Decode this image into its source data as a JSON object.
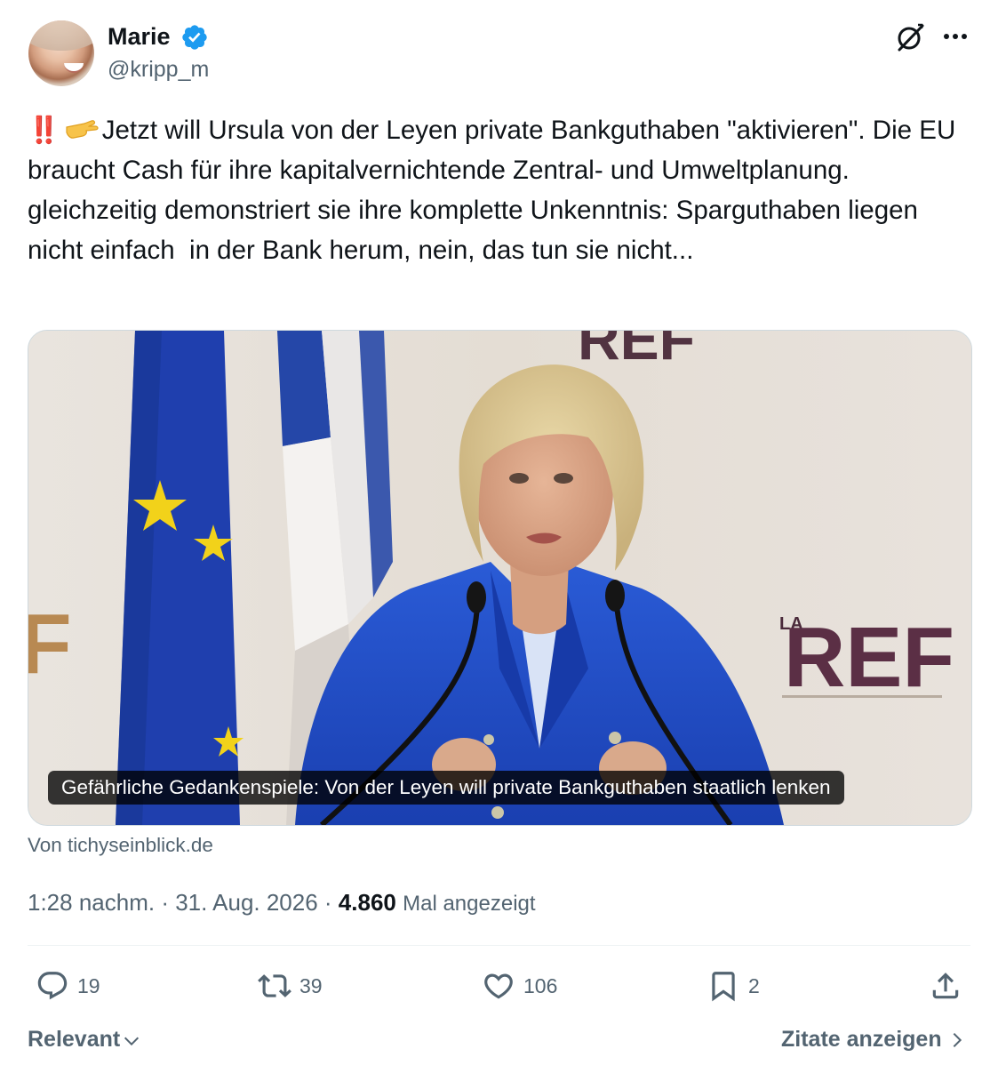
{
  "author": {
    "name": "Marie",
    "handle": "@kripp_m",
    "verified": true
  },
  "post": {
    "emoji_prefix": "‼️",
    "text": "Jetzt will Ursula von der Leyen private Bankguthaben \"aktivieren\". Die EU braucht Cash für ihre kapitalvernichtende Zentral- und Umweltplanung. gleichzeitig demonstriert sie ihre komplette Unkenntnis: Sparguthaben liegen nicht einfach  in der Bank herum, nein, das tun sie nicht..."
  },
  "card": {
    "caption": "Gefährliche Gedankenspiele: Von der Leyen will private Bankguthaben staatlich lenken",
    "source": "Von tichyseinblick.de",
    "image_text": {
      "backdrop_logo": "REF",
      "backdrop_logo_prefix": "LA"
    }
  },
  "meta": {
    "time": "1:28 nachm.",
    "sep1": " · ",
    "date": "31. Aug. 2026",
    "sep2": " · ",
    "views": "4.860",
    "views_label": "Mal angezeigt"
  },
  "actions": {
    "replies": "19",
    "reposts": "39",
    "likes": "106",
    "bookmarks": "2"
  },
  "footer": {
    "sort_label": "Relevant",
    "quotes_label": "Zitate anzeigen"
  },
  "colors": {
    "text": "#0f1419",
    "secondary": "#536471",
    "verified": "#1d9bf0",
    "border": "#cfd9de"
  },
  "icons": [
    "verified-badge-icon",
    "grok-icon",
    "more-icon",
    "reply-icon",
    "repost-icon",
    "like-icon",
    "bookmark-icon",
    "share-icon",
    "chevron-down-icon",
    "chevron-right-icon"
  ]
}
